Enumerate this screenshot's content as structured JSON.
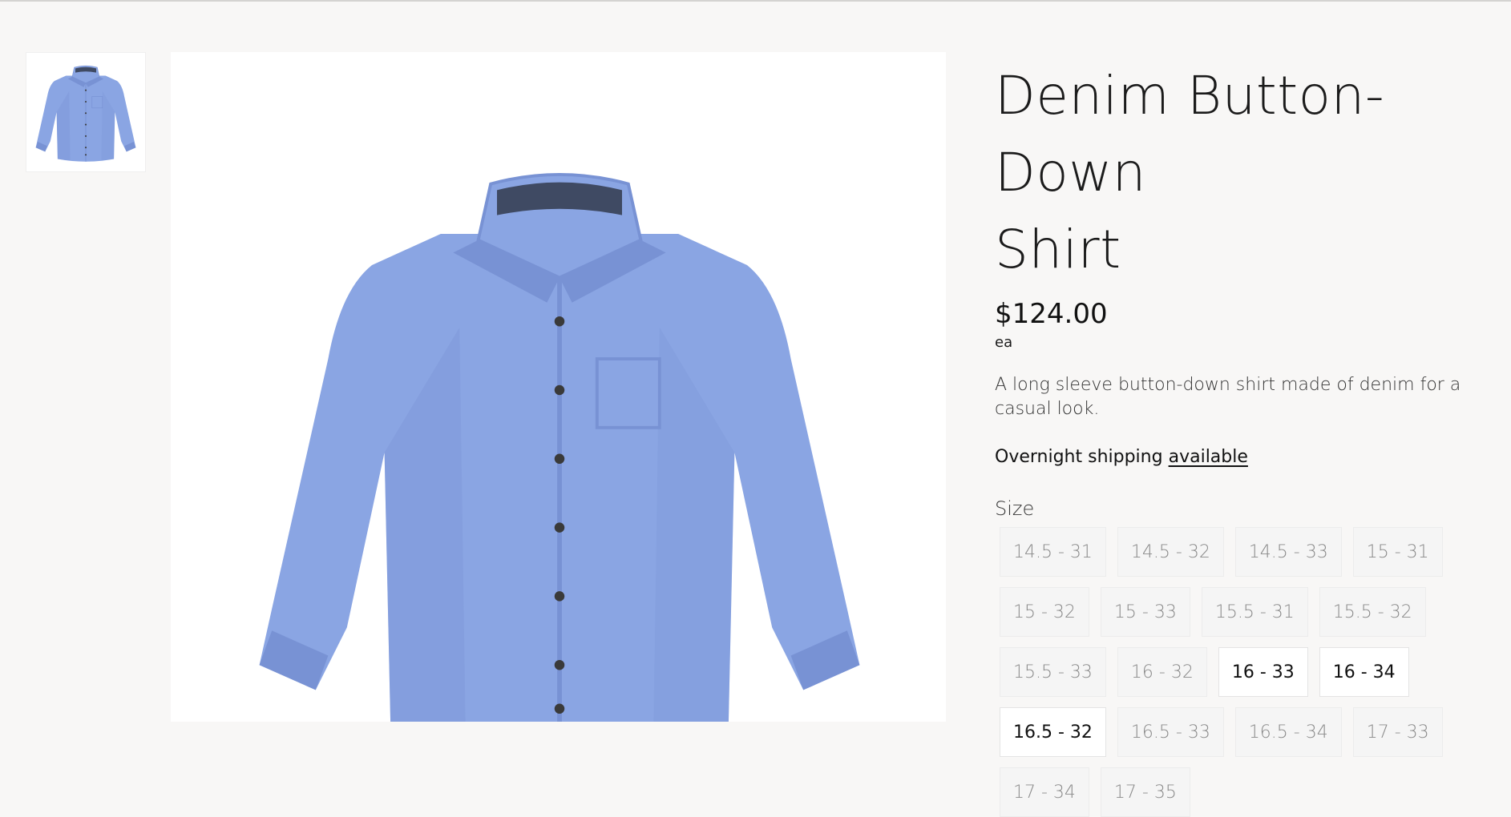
{
  "product": {
    "title_line1": "Denim Button-Down",
    "title_line2": "Shirt",
    "price": "$124.00",
    "unit": "ea",
    "description": "A long sleeve button-down shirt made of denim for a casual look.",
    "shipping_text": "Overnight shipping",
    "shipping_link": "available"
  },
  "size_selector": {
    "label": "Size",
    "options": [
      {
        "label": "14.5 - 31",
        "available": false
      },
      {
        "label": "14.5 - 32",
        "available": false
      },
      {
        "label": "14.5 - 33",
        "available": false
      },
      {
        "label": "15 - 31",
        "available": false
      },
      {
        "label": "15 - 32",
        "available": false
      },
      {
        "label": "15 - 33",
        "available": false
      },
      {
        "label": "15.5 - 31",
        "available": false
      },
      {
        "label": "15.5 - 32",
        "available": false
      },
      {
        "label": "15.5 - 33",
        "available": false
      },
      {
        "label": "16 - 32",
        "available": false
      },
      {
        "label": "16 - 33",
        "available": true
      },
      {
        "label": "16 - 34",
        "available": true
      },
      {
        "label": "16.5 - 32",
        "available": true
      },
      {
        "label": "16.5 - 33",
        "available": false
      },
      {
        "label": "16.5 - 34",
        "available": false
      },
      {
        "label": "17 - 33",
        "available": false
      },
      {
        "label": "17 - 34",
        "available": false
      },
      {
        "label": "17 - 35",
        "available": false
      }
    ]
  },
  "colors": {
    "shirt": "#8aa5e3",
    "shirt_shade": "#7892d4",
    "collar_band": "#3f4a63",
    "button": "#3a3a3a",
    "background": "#f8f7f6"
  }
}
